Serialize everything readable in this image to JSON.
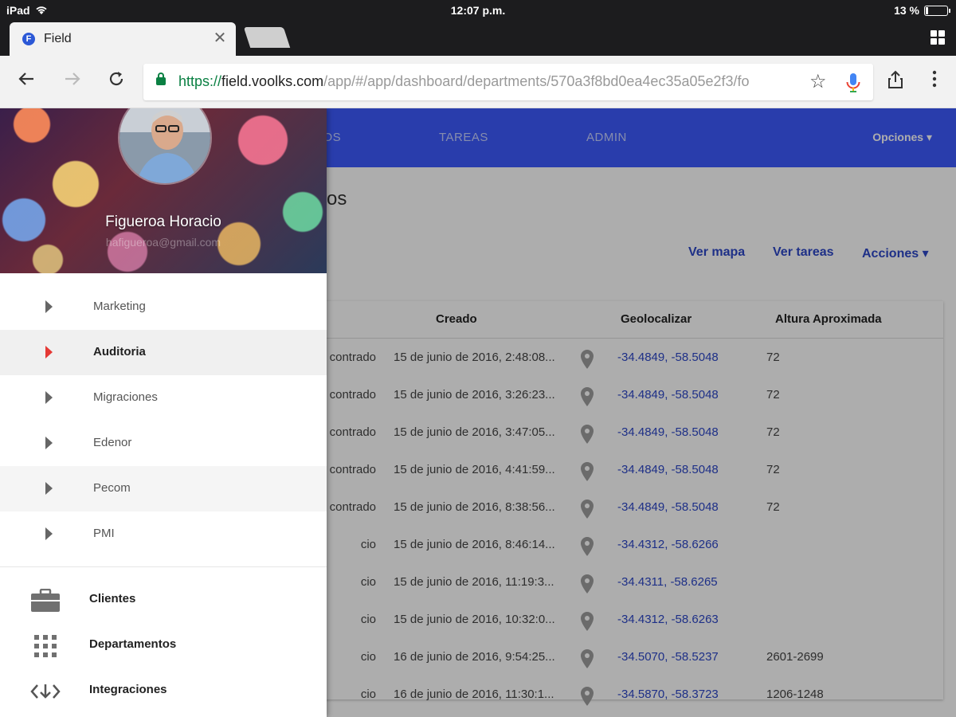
{
  "status_bar": {
    "device": "iPad",
    "time": "12:07 p.m.",
    "battery": "13 %",
    "battery_level": 0.13
  },
  "browser": {
    "tab_title": "Field",
    "favicon_letter": "F",
    "url_scheme": "https://",
    "url_host": "field.voolks.com",
    "url_path": "/app/#/app/dashboard/departments/570a3f8bd0ea4ec35a05e2f3/fo"
  },
  "app_nav": {
    "items": [
      "POS",
      "TAREAS",
      "ADMIN"
    ],
    "opciones": "Opciones ▾"
  },
  "page": {
    "title": "os",
    "actions": [
      "Ver mapa",
      "Ver tareas",
      "Acciones ▾"
    ]
  },
  "table": {
    "headers": [
      "Creado",
      "Geolocalizar",
      "Altura Aproximada"
    ],
    "rows": [
      {
        "estado": "contrado",
        "created": "15 de junio de 2016, 2:48:08...",
        "geo": "-34.4849, -58.5048",
        "alt": "72"
      },
      {
        "estado": "contrado",
        "created": "15 de junio de 2016, 3:26:23...",
        "geo": "-34.4849, -58.5048",
        "alt": "72"
      },
      {
        "estado": "contrado",
        "created": "15 de junio de 2016, 3:47:05...",
        "geo": "-34.4849, -58.5048",
        "alt": "72"
      },
      {
        "estado": "contrado",
        "created": "15 de junio de 2016, 4:41:59...",
        "geo": "-34.4849, -58.5048",
        "alt": "72"
      },
      {
        "estado": "contrado",
        "created": "15 de junio de 2016, 8:38:56...",
        "geo": "-34.4849, -58.5048",
        "alt": "72"
      },
      {
        "estado": "cio",
        "created": "15 de junio de 2016, 8:46:14...",
        "geo": "-34.4312, -58.6266",
        "alt": ""
      },
      {
        "estado": "cio",
        "created": "15 de junio de 2016, 11:19:3...",
        "geo": "-34.4311, -58.6265",
        "alt": ""
      },
      {
        "estado": "cio",
        "created": "15 de junio de 2016, 10:32:0...",
        "geo": "-34.4312, -58.6263",
        "alt": ""
      },
      {
        "estado": "cio",
        "created": "16 de junio de 2016, 9:54:25...",
        "geo": "-34.5070, -58.5237",
        "alt": "2601-2699"
      },
      {
        "estado": "cio",
        "created": "16 de junio de 2016, 11:30:1...",
        "geo": "-34.5870, -58.3723",
        "alt": "1206-1248"
      }
    ]
  },
  "drawer": {
    "user_name": "Figueroa Horacio",
    "user_email": "hafigueroa@gmail.com",
    "departments": [
      {
        "label": "Marketing",
        "state": "normal"
      },
      {
        "label": "Auditoria",
        "state": "active"
      },
      {
        "label": "Migraciones",
        "state": "normal"
      },
      {
        "label": "Edenor",
        "state": "normal"
      },
      {
        "label": "Pecom",
        "state": "shaded"
      },
      {
        "label": "PMI",
        "state": "normal"
      }
    ],
    "menu": [
      {
        "label": "Clientes",
        "icon": "briefcase-icon"
      },
      {
        "label": "Departamentos",
        "icon": "grid-icon"
      },
      {
        "label": "Integraciones",
        "icon": "integration-icon"
      }
    ]
  },
  "colors": {
    "nav_blue": "#3d5afe",
    "link_blue": "#2d47c8",
    "active_arrow": "#e53935",
    "secure_green": "#0b8043"
  }
}
